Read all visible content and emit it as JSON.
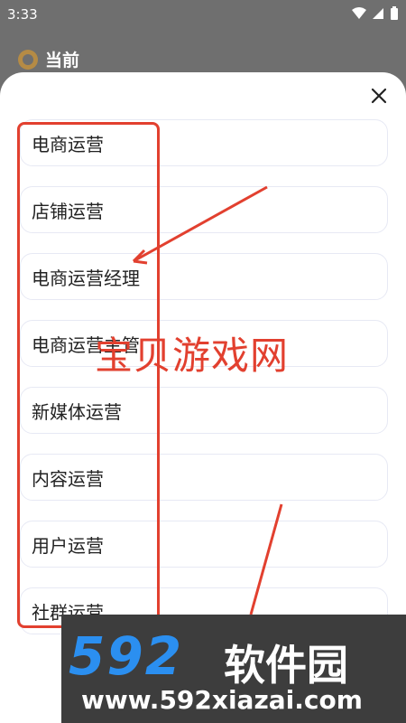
{
  "status_bar": {
    "time": "3:33"
  },
  "background_screen": {
    "title": "当前"
  },
  "sheet": {
    "options": [
      {
        "label": "电商运营"
      },
      {
        "label": "店铺运营"
      },
      {
        "label": "电商运营经理"
      },
      {
        "label": "电商运营主管"
      },
      {
        "label": "新媒体运营"
      },
      {
        "label": "内容运营"
      },
      {
        "label": "用户运营"
      },
      {
        "label": "社群运营"
      }
    ]
  },
  "watermark": {
    "overlay_text": "宝贝游戏网",
    "brand_number": "592",
    "brand_name": "软件园",
    "url": "www.592xiazai.com"
  },
  "colors": {
    "annotation_red": "#e2402f",
    "brand_blue": "#2b8ff0"
  },
  "icons": [
    "wifi-icon",
    "signal-icon",
    "battery-icon",
    "clock-icon",
    "close-icon"
  ]
}
